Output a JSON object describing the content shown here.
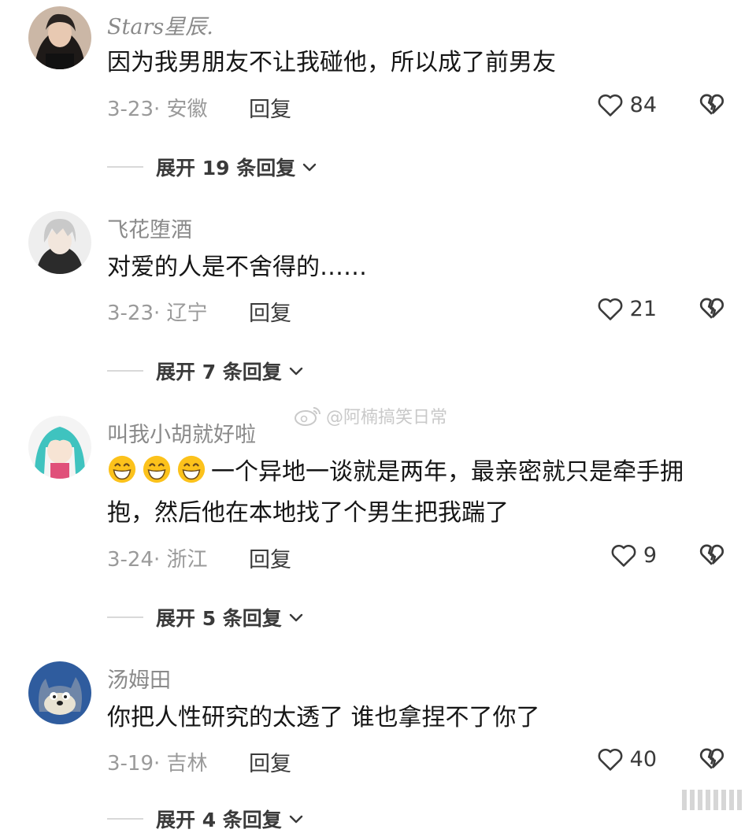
{
  "comments": [
    {
      "username": "Stars星辰.",
      "text": "因为我男朋友不让我碰他，所以成了前男友",
      "date_location": "3-23· 安徽",
      "reply_label": "回复",
      "likes": "84",
      "expand_label": "展开 19 条回复",
      "avatar_icon": "avatar-girl-photo"
    },
    {
      "username": "飞花堕酒",
      "text": "对爱的人是不舍得的……",
      "date_location": "3-23· 辽宁",
      "reply_label": "回复",
      "likes": "21",
      "expand_label": "展开 7 条回复",
      "avatar_icon": "avatar-anime-white-hair"
    },
    {
      "username": "叫我小胡就好啦",
      "text": "一个异地一谈就是两年，最亲密就只是牵手拥抱，然后他在本地找了个男生把我踹了",
      "emoji": "grinning-emoji",
      "date_location": "3-24· 浙江",
      "reply_label": "回复",
      "likes": "9",
      "expand_label": "展开 5 条回复",
      "avatar_icon": "avatar-anime-teal-hair"
    },
    {
      "username": "汤姆田",
      "text": "你把人性研究的太透了  谁也拿捏不了你了",
      "date_location": "3-19· 吉林",
      "reply_label": "回复",
      "likes": "40",
      "expand_label": "展开 4 条回复",
      "avatar_icon": "avatar-cartoon-cat"
    }
  ],
  "watermark": "@阿楠搞笑日常",
  "colors": {
    "text": "#161616",
    "meta": "#9a9a9a",
    "username": "#8a8a8a",
    "divider": "#d9d9d9",
    "icon": "#3a3a3a"
  }
}
